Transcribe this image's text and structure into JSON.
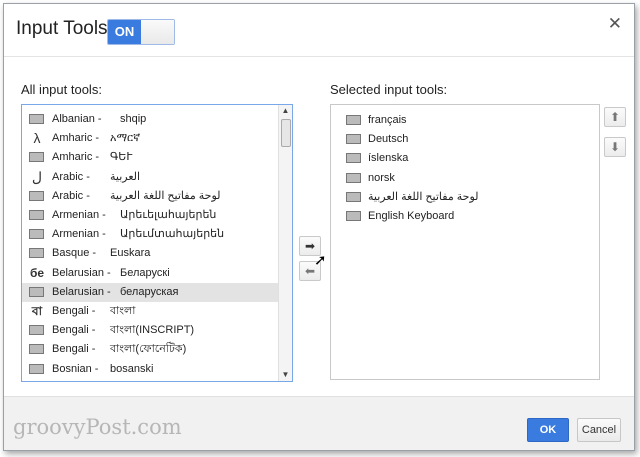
{
  "dialog": {
    "title": "Input Tools",
    "toggle_label": "ON",
    "close_glyph": "✕"
  },
  "left": {
    "label": "All input tools:",
    "items": [
      {
        "icon": "keyboard-icon",
        "glyph": "",
        "lang": "Albanian -",
        "native": "shqip"
      },
      {
        "icon": "transliteration-icon",
        "glyph": "λ",
        "lang": "Amharic -",
        "native": "አማርኛ"
      },
      {
        "icon": "keyboard-icon",
        "glyph": "",
        "lang": "Amharic -",
        "native": "ԳԵՒ"
      },
      {
        "icon": "transliteration-icon",
        "glyph": "ل",
        "lang": "Arabic -",
        "native": "العربية"
      },
      {
        "icon": "keyboard-icon",
        "glyph": "",
        "lang": "Arabic -",
        "native": "لوحة مفاتيح اللغة العربية"
      },
      {
        "icon": "keyboard-icon",
        "glyph": "",
        "lang": "Armenian -",
        "native": "Արեւելահայերեն"
      },
      {
        "icon": "keyboard-icon",
        "glyph": "",
        "lang": "Armenian -",
        "native": "Արեւմտահայերեն"
      },
      {
        "icon": "keyboard-icon",
        "glyph": "",
        "lang": "Basque -",
        "native": "Euskara"
      },
      {
        "icon": "transliteration-icon",
        "glyph": "бе",
        "lang": "Belarusian -",
        "native": "Беларускі"
      },
      {
        "icon": "keyboard-icon",
        "glyph": "",
        "lang": "Belarusian -",
        "native": "беларуская",
        "selected": true
      },
      {
        "icon": "transliteration-icon",
        "glyph": "বা",
        "lang": "Bengali -",
        "native": "বাংলা"
      },
      {
        "icon": "keyboard-icon",
        "glyph": "",
        "lang": "Bengali -",
        "native": "বাংলা(INSCRIPT)"
      },
      {
        "icon": "keyboard-icon",
        "glyph": "",
        "lang": "Bengali -",
        "native": "বাংলা(ফোনেটিক)"
      },
      {
        "icon": "keyboard-icon",
        "glyph": "",
        "lang": "Bosnian -",
        "native": "bosanski"
      }
    ]
  },
  "right": {
    "label": "Selected input tools:",
    "items": [
      {
        "icon": "keyboard-icon",
        "name": "français"
      },
      {
        "icon": "keyboard-icon",
        "name": "Deutsch"
      },
      {
        "icon": "keyboard-icon",
        "name": "íslenska"
      },
      {
        "icon": "keyboard-icon",
        "name": "norsk"
      },
      {
        "icon": "keyboard-icon",
        "name": "لوحة مفاتيح اللغة العربية"
      },
      {
        "icon": "keyboard-icon",
        "name": "English Keyboard"
      }
    ]
  },
  "transfer": {
    "add_glyph": "➡",
    "remove_glyph": "⬅"
  },
  "order": {
    "up_glyph": "⬆",
    "down_glyph": "⬇"
  },
  "scrollbar": {
    "up_glyph": "▲",
    "down_glyph": "▼"
  },
  "footer": {
    "watermark": "groovyPost.com",
    "ok_label": "OK",
    "cancel_label": "Cancel"
  },
  "colors": {
    "accent": "#3a7be0",
    "selected_row": "#e3e3e3",
    "footer_bg": "#f1f1f1"
  }
}
